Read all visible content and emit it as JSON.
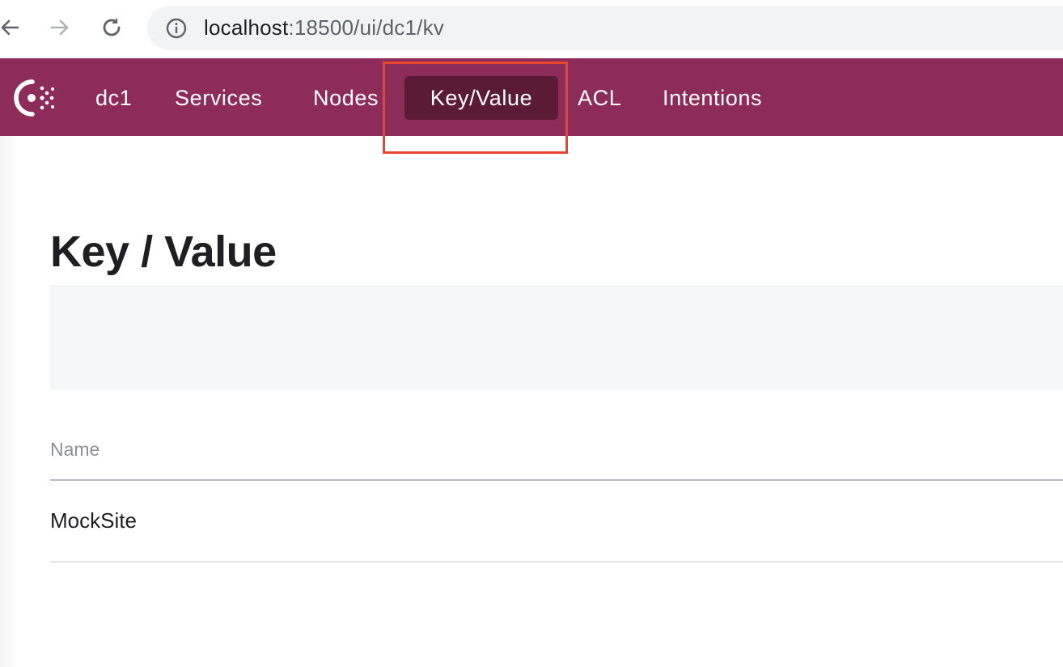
{
  "browser": {
    "url_host": "localhost",
    "url_path": ":18500/ui/dc1/kv",
    "icons": [
      "back-arrow-icon",
      "forward-arrow-icon",
      "reload-icon",
      "info-icon"
    ]
  },
  "nav": {
    "logo": "consul-logo-icon",
    "datacenter": "dc1",
    "items": [
      {
        "label": "Services"
      },
      {
        "label": "Nodes"
      },
      {
        "label": "Key/Value",
        "active": true
      },
      {
        "label": "ACL"
      },
      {
        "label": "Intentions"
      }
    ],
    "bg_color": "#8e2c59",
    "active_color": "#5b1a35"
  },
  "annotation": {
    "highlight_color": "#e8452f"
  },
  "page": {
    "title": "Key / Value",
    "table": {
      "columns": [
        "Name"
      ],
      "rows": [
        {
          "name": "MockSite"
        }
      ]
    }
  }
}
